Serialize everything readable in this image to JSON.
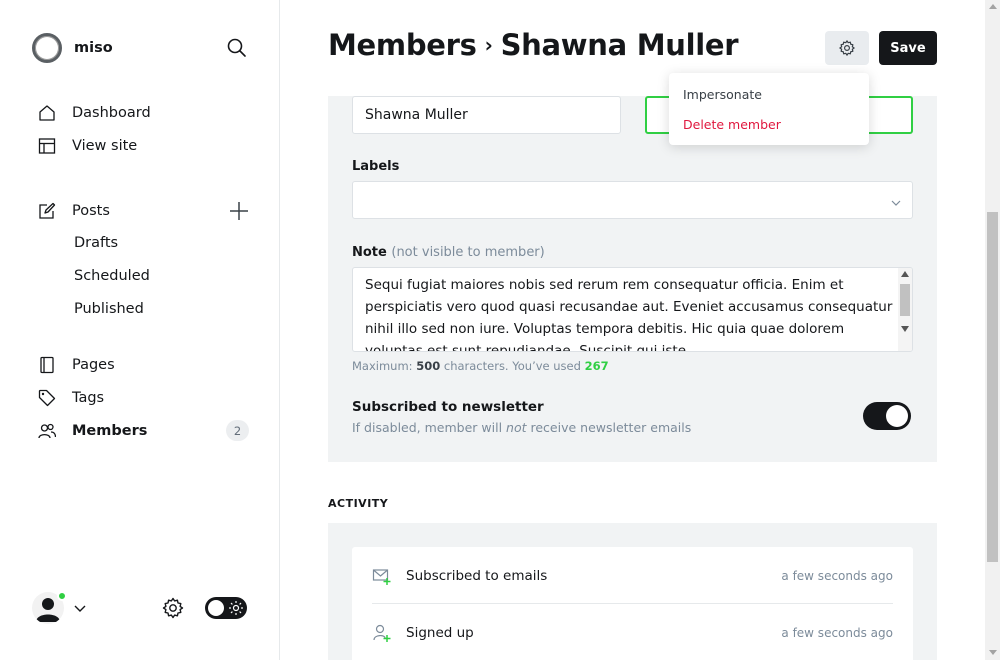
{
  "brand": {
    "name": "miso"
  },
  "sidebar": {
    "items": [
      {
        "label": "Dashboard",
        "icon": "home-icon"
      },
      {
        "label": "View site",
        "icon": "layout-icon"
      },
      {
        "label": "Posts",
        "icon": "edit-icon"
      },
      {
        "label": "Drafts"
      },
      {
        "label": "Scheduled"
      },
      {
        "label": "Published"
      },
      {
        "label": "Pages",
        "icon": "page-icon"
      },
      {
        "label": "Tags",
        "icon": "tag-icon"
      },
      {
        "label": "Members",
        "icon": "members-icon",
        "count": "2",
        "active": true
      }
    ]
  },
  "header": {
    "section": "Members",
    "separator": "›",
    "member_name": "Shawna Muller",
    "save_label": "Save"
  },
  "dropdown": {
    "impersonate": "Impersonate",
    "delete": "Delete member"
  },
  "form": {
    "name_value": "Shawna Muller",
    "labels_label": "Labels",
    "note_label": "Note",
    "note_hint": "(not visible to member)",
    "note_value": "Sequi fugiat maiores nobis sed rerum rem consequatur officia. Enim et perspiciatis vero quod quasi recusandae aut. Eveniet accusamus consequatur nihil illo sed non iure. Voluptas tempora debitis. Hic quia quae dolorem voluptas est sunt repudiandae. Suscipit qui iste.",
    "max_prefix": "Maximum: ",
    "max_value": "500",
    "max_mid": " characters. You’ve used ",
    "used_value": "267",
    "newsletter_title": "Subscribed to newsletter",
    "newsletter_desc_a": "If disabled, member will ",
    "newsletter_desc_em": "not",
    "newsletter_desc_b": " receive newsletter emails",
    "newsletter_enabled": true
  },
  "activity": {
    "heading": "ACTIVITY",
    "events": [
      {
        "label": "Subscribed to emails",
        "time": "a few seconds ago",
        "icon": "email-plus-icon"
      },
      {
        "label": "Signed up",
        "time": "a few seconds ago",
        "icon": "user-plus-icon"
      }
    ]
  },
  "colors": {
    "accent": "#30cf43",
    "danger": "#e0173e",
    "dark": "#15171a"
  }
}
